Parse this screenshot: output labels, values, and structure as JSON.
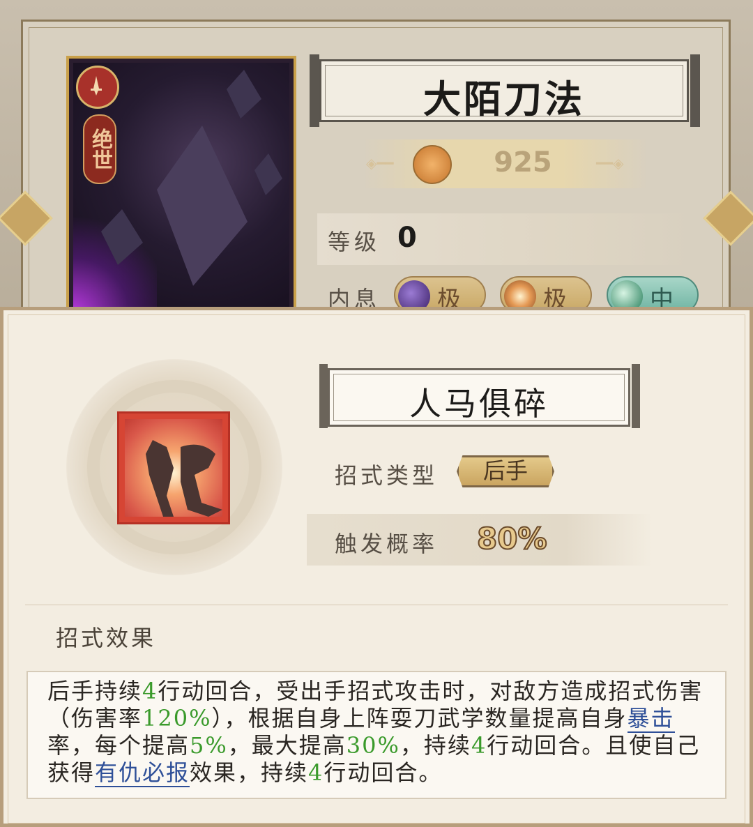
{
  "card": {
    "rank_label": "绝世",
    "colors": {
      "frame": "#c9a04a",
      "glow": "#b83adf"
    }
  },
  "header": {
    "title": "大陌刀法",
    "power_value": "925",
    "power_icon": "sword-crest-icon"
  },
  "stats": {
    "level_label": "等级",
    "level_value": "0",
    "neixi_label": "内息",
    "neixi": [
      {
        "icon": "dark-moon-orb-icon",
        "grade": "极",
        "color": "#5b3a8c"
      },
      {
        "icon": "sun-orb-icon",
        "grade": "极",
        "color": "#d17a3a"
      },
      {
        "icon": "green-crescent-orb-icon",
        "grade": "中",
        "color": "#2f8f6a"
      }
    ]
  },
  "skill": {
    "name": "人马俱碎",
    "icon": "horse-warrior-skill-icon",
    "type_label": "招式类型",
    "type_value": "后手",
    "trigger_label": "触发概率",
    "trigger_value": "80%"
  },
  "effect": {
    "section_title": "招式效果",
    "segments": [
      {
        "t": "后手持续",
        "s": "n"
      },
      {
        "t": "4",
        "s": "g"
      },
      {
        "t": "行动回合，受出手招式攻击时，对敌方造成招式伤害（伤害率",
        "s": "n"
      },
      {
        "t": "120%",
        "s": "g"
      },
      {
        "t": "），根据自身上阵耍刀武学数量提高自身",
        "s": "n"
      },
      {
        "t": "暴击",
        "s": "k"
      },
      {
        "t": "率，每个提高",
        "s": "n"
      },
      {
        "t": "5%",
        "s": "g"
      },
      {
        "t": "，最大提高",
        "s": "n"
      },
      {
        "t": "30%",
        "s": "g"
      },
      {
        "t": "，持续",
        "s": "n"
      },
      {
        "t": "4",
        "s": "g"
      },
      {
        "t": "行动回合。且使自己获得",
        "s": "n"
      },
      {
        "t": "有仇必报",
        "s": "k"
      },
      {
        "t": "效果，持续",
        "s": "n"
      },
      {
        "t": "4",
        "s": "g"
      },
      {
        "t": "行动回合。",
        "s": "n"
      }
    ]
  }
}
